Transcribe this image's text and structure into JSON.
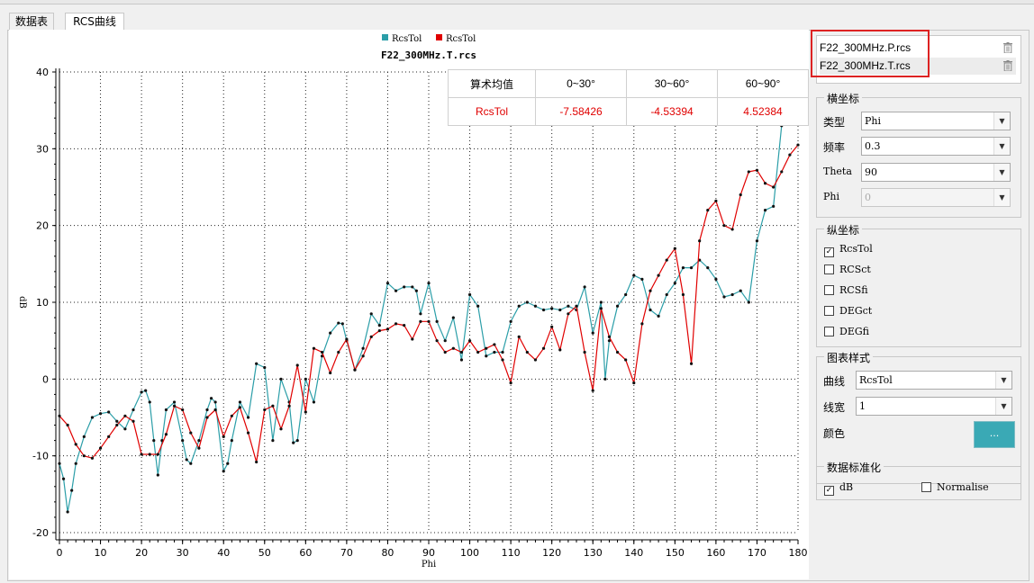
{
  "tabs": [
    "数据表",
    "RCS曲线"
  ],
  "chart": {
    "title": "F22_300MHz.T.rcs",
    "legend": [
      {
        "name": "RcsTol",
        "color": "#2b9ea8"
      },
      {
        "name": "RcsTol",
        "color": "#e00000"
      }
    ],
    "xlabel": "Phi",
    "ylabel": "dB"
  },
  "stats": {
    "header": [
      "算术均值",
      "0~30°",
      "30~60°",
      "60~90°"
    ],
    "row": [
      "RcsTol",
      "-7.58426",
      "-4.53394",
      "4.52384"
    ]
  },
  "files": [
    {
      "name": "F22_300MHz.P.rcs",
      "icon": "trash-icon"
    },
    {
      "name": "F22_300MHz.T.rcs",
      "icon": "trash-icon"
    }
  ],
  "xaxis": {
    "title": "横坐标",
    "type_label": "类型",
    "type_value": "Phi",
    "freq_label": "频率",
    "freq_value": "0.3",
    "theta_label": "Theta",
    "theta_value": "90",
    "phi_label": "Phi",
    "phi_value": "0"
  },
  "yaxis": {
    "title": "纵坐标",
    "options": [
      {
        "label": "RcsTol",
        "checked": true
      },
      {
        "label": "RCSct",
        "checked": false
      },
      {
        "label": "RCSfi",
        "checked": false
      },
      {
        "label": "DEGct",
        "checked": false
      },
      {
        "label": "DEGfi",
        "checked": false
      }
    ]
  },
  "style": {
    "title": "图表样式",
    "curve_label": "曲线",
    "curve_value": "RcsTol",
    "width_label": "线宽",
    "width_value": "1",
    "color_label": "颜色",
    "color_button": "...",
    "color_value": "#3aa9b5"
  },
  "normalize": {
    "title": "数据标准化",
    "db_label": "dB",
    "db_checked": true,
    "norm_label": "Normalise",
    "norm_checked": false
  },
  "chart_data": {
    "type": "line",
    "title": "F22_300MHz.T.rcs",
    "xlabel": "Phi",
    "ylabel": "dB",
    "xlim": [
      0,
      180
    ],
    "ylim": [
      -20,
      40
    ],
    "xticks": [
      0,
      10,
      20,
      30,
      40,
      50,
      60,
      70,
      80,
      90,
      100,
      110,
      120,
      130,
      140,
      150,
      160,
      170,
      180
    ],
    "yticks": [
      -20,
      -10,
      0,
      10,
      20,
      30,
      40
    ],
    "grid": true,
    "legend_position": "top-center",
    "series": [
      {
        "name": "RcsTol",
        "color": "#2b9ea8",
        "x": [
          0,
          1,
          2,
          3,
          4,
          6,
          8,
          10,
          12,
          14,
          16,
          18,
          20,
          21,
          22,
          23,
          24,
          25,
          26,
          28,
          30,
          31,
          32,
          34,
          36,
          37,
          38,
          40,
          41,
          42,
          44,
          46,
          48,
          50,
          52,
          54,
          56,
          57,
          58,
          60,
          62,
          64,
          66,
          68,
          69,
          70,
          72,
          74,
          76,
          78,
          80,
          82,
          84,
          86,
          87,
          88,
          90,
          92,
          94,
          96,
          98,
          100,
          102,
          104,
          106,
          108,
          110,
          112,
          114,
          116,
          118,
          120,
          122,
          124,
          126,
          128,
          130,
          132,
          133,
          134,
          136,
          138,
          140,
          142,
          144,
          146,
          148,
          150,
          152,
          154,
          156,
          158,
          160,
          162,
          164,
          166,
          168,
          170,
          172,
          174,
          176,
          178
        ],
        "y": [
          -11,
          -13,
          -17.3,
          -14.5,
          -11,
          -7.5,
          -5,
          -4.5,
          -4.3,
          -5.5,
          -6.5,
          -4,
          -1.7,
          -1.5,
          -3,
          -8,
          -12.5,
          -8,
          -4,
          -3,
          -8,
          -10.5,
          -11,
          -8,
          -4,
          -2.5,
          -3,
          -12,
          -11,
          -8,
          -3,
          -5,
          2,
          1.5,
          -8,
          0,
          -3,
          -8.3,
          -8,
          0,
          -3,
          3,
          6,
          7.3,
          7.2,
          5,
          1.2,
          4,
          8.5,
          7,
          12.5,
          11.5,
          12,
          12,
          11.5,
          8.5,
          12.5,
          7.5,
          5,
          8,
          2.5,
          11,
          9.5,
          3,
          3.5,
          3.5,
          7.5,
          9.5,
          10,
          9.5,
          9,
          9.2,
          9,
          9.5,
          9,
          12,
          6,
          10,
          0,
          5,
          9.5,
          11,
          13.5,
          13,
          9,
          8.2,
          11,
          12.5,
          14.5,
          14.5,
          15.5,
          14.5,
          13,
          10.7,
          11,
          11.5,
          10,
          18,
          22,
          22.5,
          33,
          38
        ]
      },
      {
        "name": "RcsTol",
        "color": "#e00000",
        "x": [
          0,
          2,
          4,
          6,
          8,
          10,
          12,
          14,
          16,
          18,
          20,
          22,
          24,
          26,
          28,
          30,
          32,
          34,
          36,
          38,
          40,
          42,
          44,
          46,
          48,
          50,
          52,
          54,
          56,
          58,
          60,
          62,
          64,
          66,
          68,
          70,
          72,
          74,
          76,
          78,
          80,
          82,
          84,
          86,
          88,
          90,
          92,
          94,
          96,
          98,
          100,
          102,
          104,
          106,
          108,
          110,
          112,
          114,
          116,
          118,
          120,
          122,
          124,
          126,
          128,
          130,
          132,
          134,
          136,
          138,
          140,
          142,
          144,
          146,
          148,
          150,
          152,
          154,
          156,
          158,
          160,
          162,
          164,
          166,
          168,
          170,
          172,
          174,
          176,
          178,
          180
        ],
        "y": [
          -4.8,
          -6,
          -8.5,
          -10,
          -10.3,
          -9,
          -7.5,
          -6,
          -4.8,
          -5.5,
          -9.8,
          -9.8,
          -9.8,
          -7.2,
          -3.5,
          -4,
          -7,
          -9,
          -5,
          -4,
          -7.5,
          -4.8,
          -3.7,
          -7,
          -10.8,
          -4,
          -3.5,
          -6.5,
          -3.5,
          1.8,
          -4.3,
          4,
          3.5,
          0.8,
          3.5,
          5.2,
          1.2,
          3,
          5.5,
          6.3,
          6.5,
          7.2,
          7,
          5.2,
          7.5,
          7.5,
          5,
          3.5,
          4,
          3.5,
          5,
          3.5,
          4,
          4.5,
          2.5,
          -0.5,
          5.5,
          3.5,
          2.5,
          4,
          6.8,
          3.8,
          8.5,
          9.5,
          3.5,
          -1.5,
          9.2,
          5.5,
          3.5,
          2.5,
          -0.5,
          7.2,
          11.5,
          13.5,
          15.5,
          17,
          11,
          2,
          18,
          22,
          23.2,
          20,
          19.5,
          24,
          27,
          27.2,
          25.5,
          25,
          27,
          29.2,
          30.5
        ]
      }
    ]
  }
}
